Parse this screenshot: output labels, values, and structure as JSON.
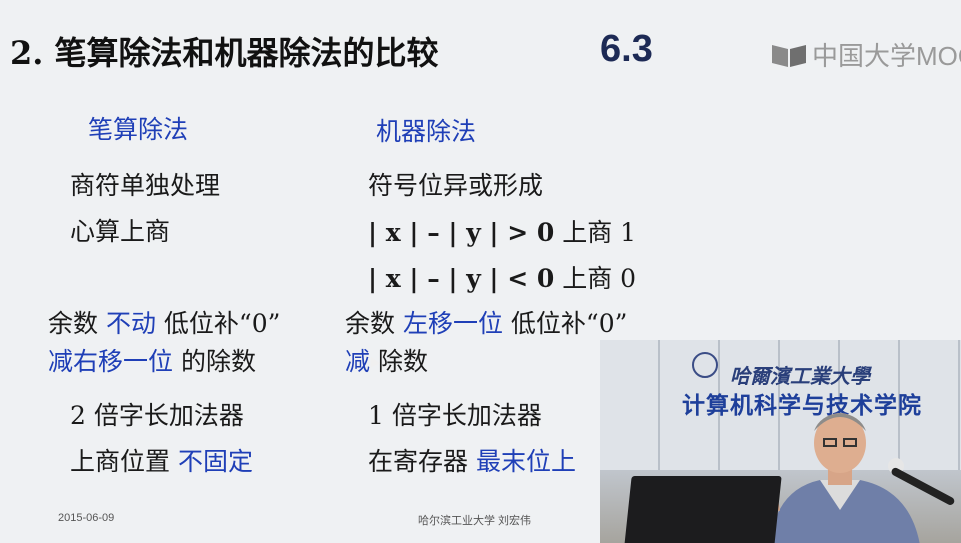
{
  "slide": {
    "title": "2. 笔算除法和机器除法的比较",
    "section_number": "6.3",
    "logo_text": "中国大学MOOC",
    "headers": {
      "left": "笔算除法",
      "right": "机器除法"
    },
    "left_rows": {
      "r1": "商符单独处理",
      "r2": "心算上商",
      "r3_a": "余数 ",
      "r3_b": "不动",
      "r3_c": " 低位补“0”",
      "r4_a": "减右移一位",
      "r4_b": " 的除数",
      "r5": "2 倍字长加法器",
      "r6_a": "上商位置 ",
      "r6_b": "不固定"
    },
    "right_rows": {
      "r1": "符号位异或形成",
      "r2_math": "| x | – | y | > 0",
      "r2_tail": " 上商 1",
      "r3_math": "| x | – | y | < 0",
      "r3_tail": " 上商 0",
      "r4_a": "余数 ",
      "r4_b": "左移一位",
      "r4_c": " 低位补“0”",
      "r5_a": "减",
      "r5_b": " 除数",
      "r6": "1 倍字长加法器",
      "r7_a": "在寄存器 ",
      "r7_b": "最末位上"
    },
    "footer": {
      "date": "2015-06-09",
      "credit": "哈尔滨工业大学  刘宏伟"
    }
  },
  "video": {
    "banner_top": "哈爾濱工業大學",
    "banner_bottom": "计算机科学与技术学院"
  },
  "colors": {
    "accent_blue": "#1f3fb7",
    "title_dark": "#1d2a55"
  }
}
